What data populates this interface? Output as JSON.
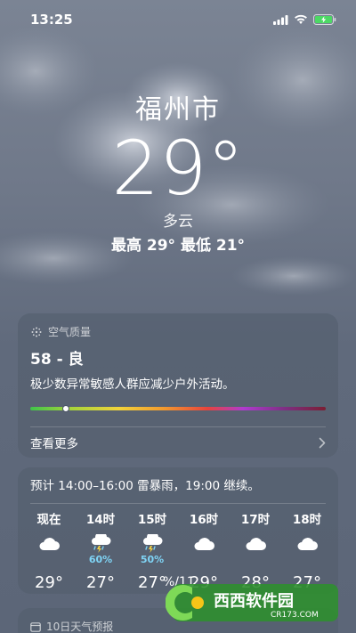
{
  "status_bar": {
    "time": "13:25"
  },
  "current": {
    "city": "福州市",
    "temperature": "29°",
    "condition": "多云",
    "hi_lo": "最高 29°  最低 21°"
  },
  "air_quality": {
    "title": "空气质量",
    "value": "58 - 良",
    "description": "极少数异常敏感人群应减少户外活动。",
    "index_fraction": 0.12,
    "more_label": "查看更多"
  },
  "hourly": {
    "summary": "预计 14:00–16:00 雷暴雨，19:00 继续。",
    "hours": [
      {
        "label": "现在",
        "icon": "cloud-icon",
        "pop": "",
        "temp": "29°"
      },
      {
        "label": "14时",
        "icon": "thunderstorm-icon",
        "pop": "60%",
        "temp": "27°"
      },
      {
        "label": "15时",
        "icon": "thunderstorm-icon",
        "pop": "50%",
        "temp": "27°"
      },
      {
        "label": "16时",
        "icon": "cloud-icon",
        "pop": "",
        "temp": "29°"
      },
      {
        "label": "17时",
        "icon": "cloud-icon",
        "pop": "",
        "temp": "28°"
      },
      {
        "label": "18时",
        "icon": "cloud-icon",
        "pop": "",
        "temp": "27°"
      }
    ]
  },
  "daily": {
    "title": "10日天气预报"
  },
  "watermark": {
    "text": "西西软件园",
    "site": "CR173.COM",
    "overlap_text": "%/11"
  },
  "colors": {
    "pop": "#7fd4f5",
    "accent_green": "#3fc44a"
  }
}
